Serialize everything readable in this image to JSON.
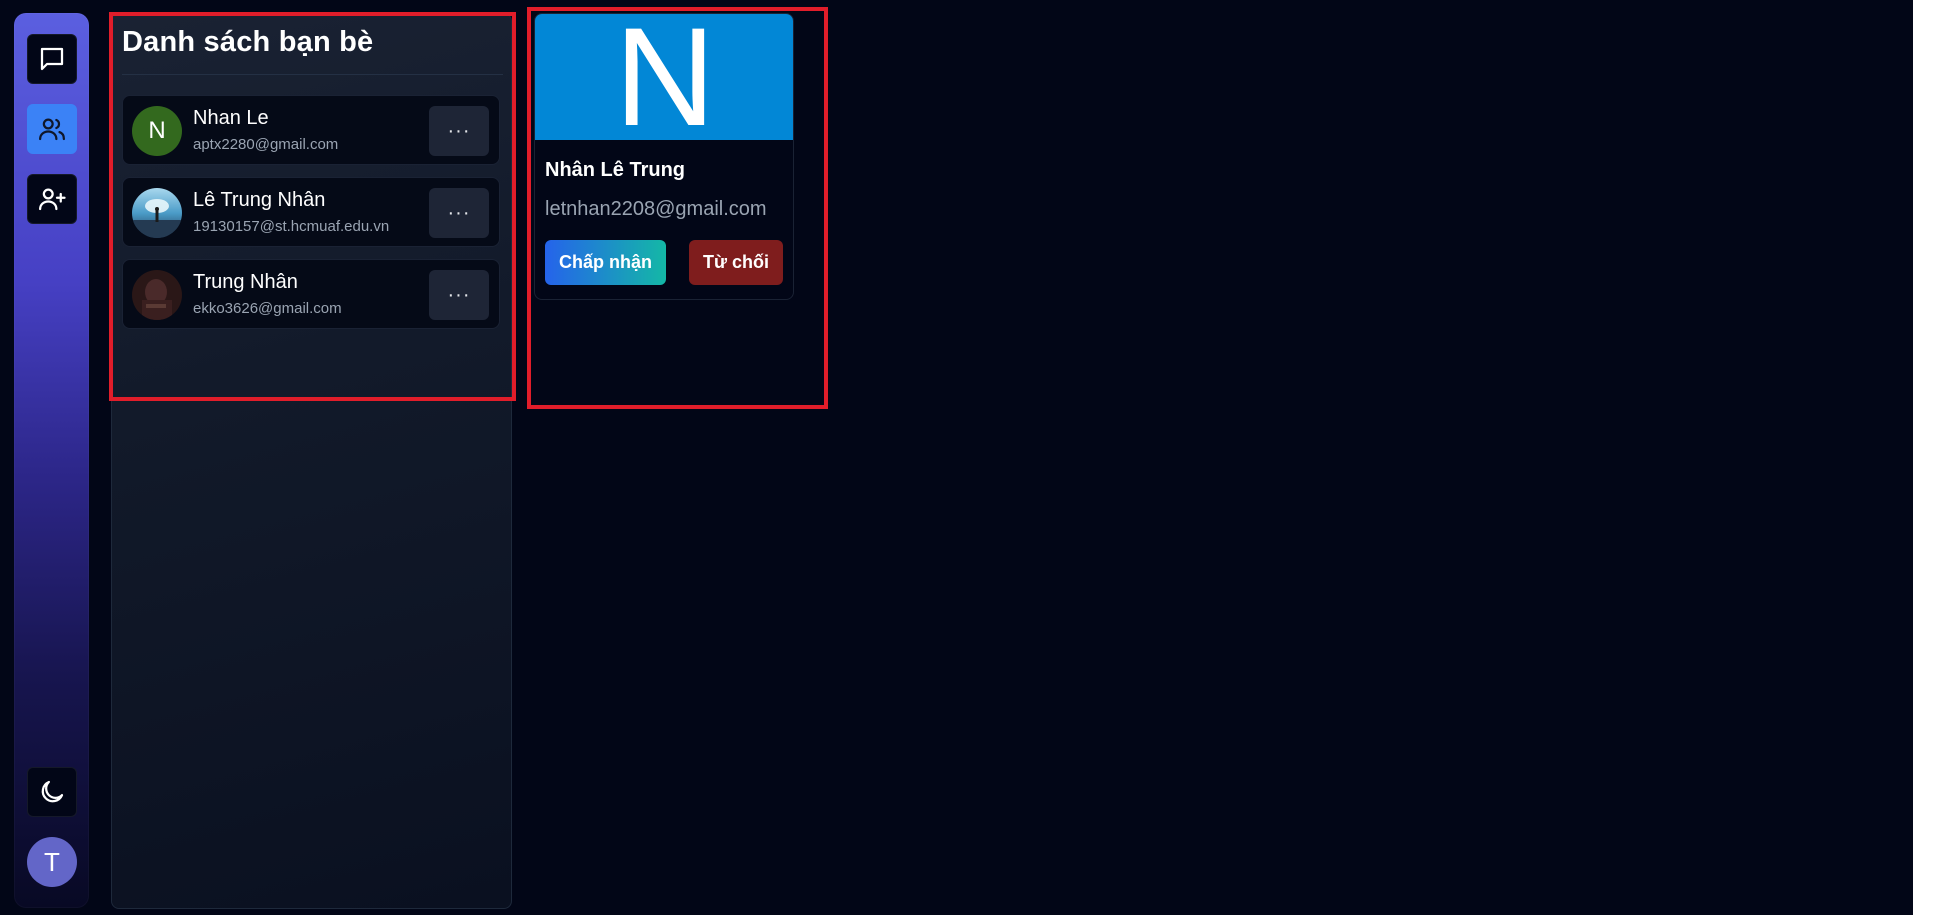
{
  "rail": {
    "items": [
      {
        "icon": "chat-icon",
        "active": false
      },
      {
        "icon": "users-icon",
        "active": true
      },
      {
        "icon": "add-user-icon",
        "active": false
      }
    ],
    "theme_icon": "moon-icon",
    "user_initial": "T"
  },
  "friends": {
    "title": "Danh sách bạn bè",
    "items": [
      {
        "name": "Nhan Le",
        "email": "aptx2280@gmail.com",
        "avatar_initial": "N",
        "avatar_color": "#33691e",
        "more_label": "···"
      },
      {
        "name": "Lê Trung Nhân",
        "email": "19130157@st.hcmuaf.edu.vn",
        "avatar_initial": "",
        "avatar_color": "#6fb3d6",
        "more_label": "···"
      },
      {
        "name": "Trung Nhân",
        "email": "ekko3626@gmail.com",
        "avatar_initial": "",
        "avatar_color": "#3a1f1f",
        "more_label": "···"
      }
    ]
  },
  "request": {
    "banner_letter": "N",
    "banner_color": "#0287d6",
    "name": "Nhân Lê Trung",
    "email": "letnhan2208@gmail.com",
    "accept_label": "Chấp nhận",
    "reject_label": "Từ chối"
  },
  "colors": {
    "accent": "#3b82f6",
    "background": "#020617",
    "highlight": "#e11d2a",
    "reject": "#7f1d1d"
  }
}
